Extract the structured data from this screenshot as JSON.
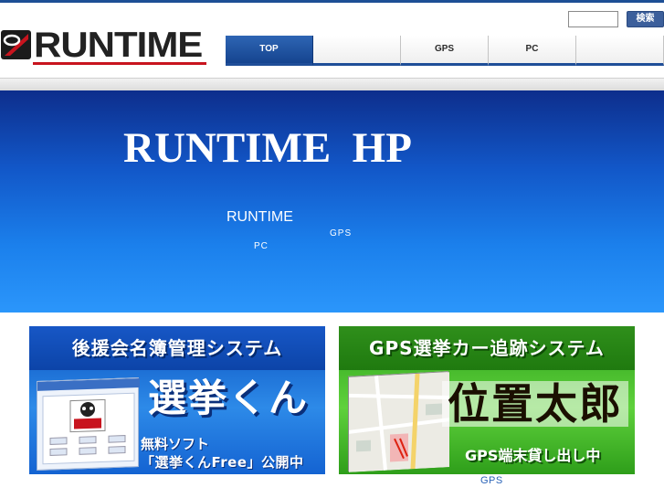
{
  "header": {
    "logo_text": "RUNTIME",
    "search": {
      "value": "",
      "placeholder": ""
    },
    "search_button_label": "検索"
  },
  "nav": {
    "items": [
      {
        "label": "TOP"
      },
      {
        "label": ""
      },
      {
        "label": "GPS"
      },
      {
        "label": "PC"
      },
      {
        "label": ""
      }
    ]
  },
  "hero": {
    "title": "RUNTIME  HP",
    "line1": "RUNTIME",
    "line2": "GPS",
    "line3": "PC"
  },
  "banners": {
    "left": {
      "heading": "後援会名簿管理システム",
      "title": "選挙くん",
      "line1": "無料ソフト",
      "line2": "「選挙くんFree」公開中"
    },
    "right": {
      "heading": "GPS選挙カー追跡システム",
      "title": "位置太郎",
      "subtitle": "GPS端末貸し出し中"
    }
  },
  "caption": "GPS",
  "colors": {
    "nav_active": "#1f4e98",
    "hero_top": "#0d2e8c",
    "hero_bottom": "#2b96fb",
    "logo_red": "#c8141e",
    "banner_left": "#1463d2",
    "banner_right": "#3eb524"
  }
}
